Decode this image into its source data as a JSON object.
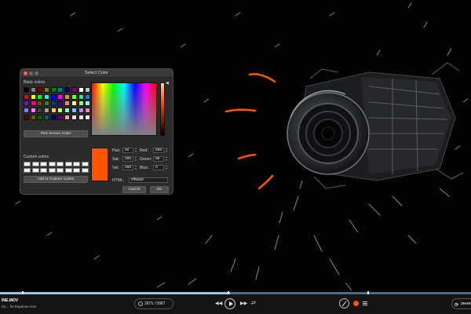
{
  "dialog": {
    "title": "Select Color",
    "basic_colors_label": "Basic colors",
    "pick_screen_label": "Pick Screen Color",
    "custom_colors_label": "Custom colors",
    "add_custom_label": "Add to Custom Colors",
    "cancel_label": "Cancel",
    "ok_label": "OK",
    "selected_color": "#ff5500",
    "basic_colors": [
      "#000000",
      "#808080",
      "#800000",
      "#808000",
      "#008000",
      "#008080",
      "#000080",
      "#800080",
      "#ffffff",
      "#c0c0c0",
      "#ff0000",
      "#ffff00",
      "#00ff00",
      "#00ffff",
      "#0000ff",
      "#ff00ff",
      "#ff8040",
      "#80ff00",
      "#00ff80",
      "#0080ff",
      "#8000ff",
      "#ff0080",
      "#804000",
      "#408000",
      "#004080",
      "#400080",
      "#ff8080",
      "#ffff80",
      "#80ff80",
      "#80ffff",
      "#8080ff",
      "#ff80ff",
      "#404040",
      "#a0a0a0",
      "#ffc080",
      "#c0ff80",
      "#80ffc0",
      "#80c0ff",
      "#c080ff",
      "#ff80c0",
      "#600000",
      "#606000",
      "#006000",
      "#006060",
      "#000060",
      "#600060",
      "#ffa0a0",
      "#e0e0e0",
      "#ffe0c0",
      "#f0f0f0"
    ],
    "fields": {
      "hue_label": "Hue:",
      "hue": "20",
      "sat_label": "Sat:",
      "sat": "255",
      "val_label": "Val:",
      "val": "255",
      "red_label": "Red:",
      "red": "255",
      "green_label": "Green:",
      "green": "85",
      "blue_label": "Blue:",
      "blue": "0",
      "html_label": "HTML:",
      "html": "#ff5500"
    }
  },
  "player": {
    "file_name": "INE.MOV",
    "file_subtitle": "nic... he Expanse.mov",
    "frame_counter": "2875 / 5887",
    "share_label": "SHAR",
    "progress_fraction": 0.488,
    "accent_color": "#ff5500"
  },
  "icons": {
    "rewind": "rewind-icon",
    "play": "play-icon",
    "forward": "fast-forward-icon",
    "loop": "loop-icon",
    "pen": "pen-icon",
    "record": "record-icon",
    "layers": "layers-icon",
    "share": "share-icon"
  }
}
